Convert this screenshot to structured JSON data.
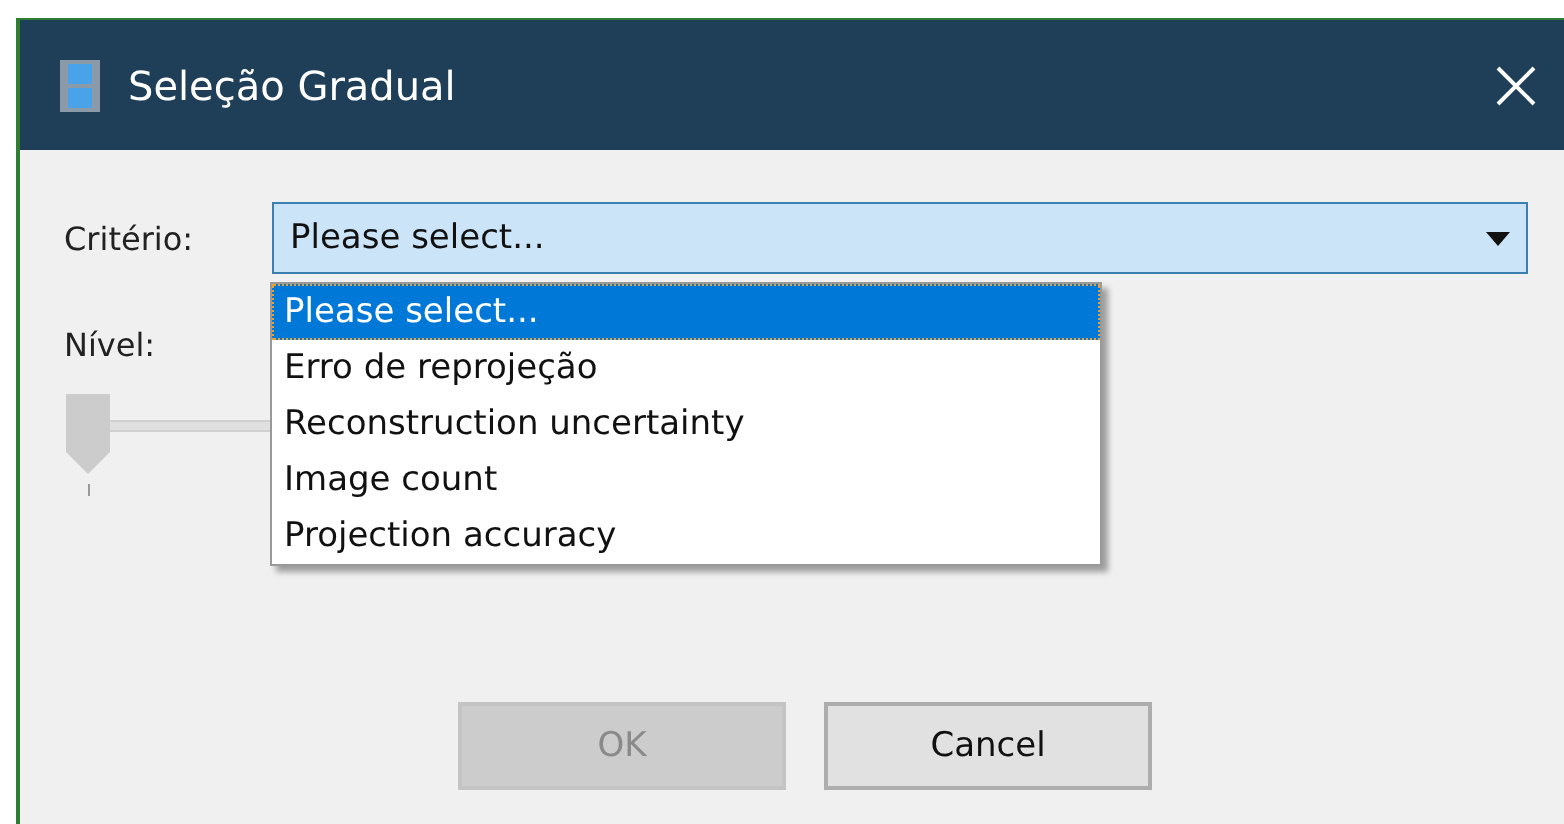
{
  "window": {
    "title": "Seleção Gradual"
  },
  "criterion": {
    "label": "Critério:",
    "value": "Please select...",
    "expanded": true,
    "options": [
      {
        "label": "Please select...",
        "selected": true
      },
      {
        "label": "Erro de reprojeção",
        "selected": false
      },
      {
        "label": "Reconstruction uncertainty",
        "selected": false
      },
      {
        "label": "Image count",
        "selected": false
      },
      {
        "label": "Projection accuracy",
        "selected": false
      }
    ]
  },
  "level": {
    "label": "Nível:",
    "level": 0,
    "disabled": true
  },
  "buttons": [
    {
      "label": "OK",
      "disabled": true
    },
    {
      "label": "Cancel",
      "disabled": false
    }
  ]
}
